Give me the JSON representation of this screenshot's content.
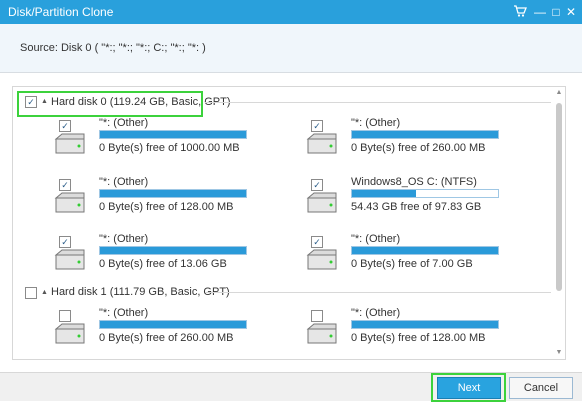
{
  "window": {
    "title": "Disk/Partition Clone",
    "cart_icon": "shopping-cart-icon",
    "minimize_glyph": "—",
    "restore_glyph": "□",
    "close_glyph": "✕"
  },
  "source": {
    "label": "Source:  Disk 0 ( \"*:; \"*:; \"*:; C:; \"*:; \"*: )"
  },
  "disks": [
    {
      "label": "Hard disk 0 (119.24 GB, Basic, GPT)",
      "checked": true,
      "check_glyph": "✓",
      "expand_glyph": "▲",
      "partitions": [
        {
          "name": "\"*: (Other)",
          "free": "0 Byte(s) free of 1000.00 MB",
          "used_fraction": 1.0,
          "checked": true,
          "check_glyph": "✓"
        },
        {
          "name": "\"*: (Other)",
          "free": "0 Byte(s) free of 260.00 MB",
          "used_fraction": 1.0,
          "checked": true,
          "check_glyph": "✓"
        },
        {
          "name": "\"*: (Other)",
          "free": "0 Byte(s) free of 128.00 MB",
          "used_fraction": 1.0,
          "checked": true,
          "check_glyph": "✓"
        },
        {
          "name": "Windows8_OS C: (NTFS)",
          "free": "54.43 GB free of 97.83 GB",
          "used_fraction": 0.44,
          "checked": true,
          "check_glyph": "✓"
        },
        {
          "name": "\"*: (Other)",
          "free": "0 Byte(s) free of 13.06 GB",
          "used_fraction": 1.0,
          "checked": true,
          "check_glyph": "✓"
        },
        {
          "name": "\"*: (Other)",
          "free": "0 Byte(s) free of 7.00 GB",
          "used_fraction": 1.0,
          "checked": true,
          "check_glyph": "✓"
        }
      ]
    },
    {
      "label": "Hard disk 1 (111.79 GB, Basic, GPT)",
      "checked": false,
      "check_glyph": "",
      "expand_glyph": "▲",
      "partitions": [
        {
          "name": "\"*: (Other)",
          "free": "0 Byte(s) free of 260.00 MB",
          "used_fraction": 1.0,
          "checked": false,
          "check_glyph": ""
        },
        {
          "name": "\"*: (Other)",
          "free": "0 Byte(s) free of 128.00 MB",
          "used_fraction": 1.0,
          "checked": false,
          "check_glyph": ""
        }
      ]
    }
  ],
  "scrollbar": {
    "up_glyph": "▲",
    "down_glyph": "▼"
  },
  "buttons": {
    "next": "Next",
    "cancel": "Cancel"
  },
  "colors": {
    "accent": "#29a0dc",
    "highlight": "#3cd23c",
    "bar_fill": "#2a9ad9"
  }
}
